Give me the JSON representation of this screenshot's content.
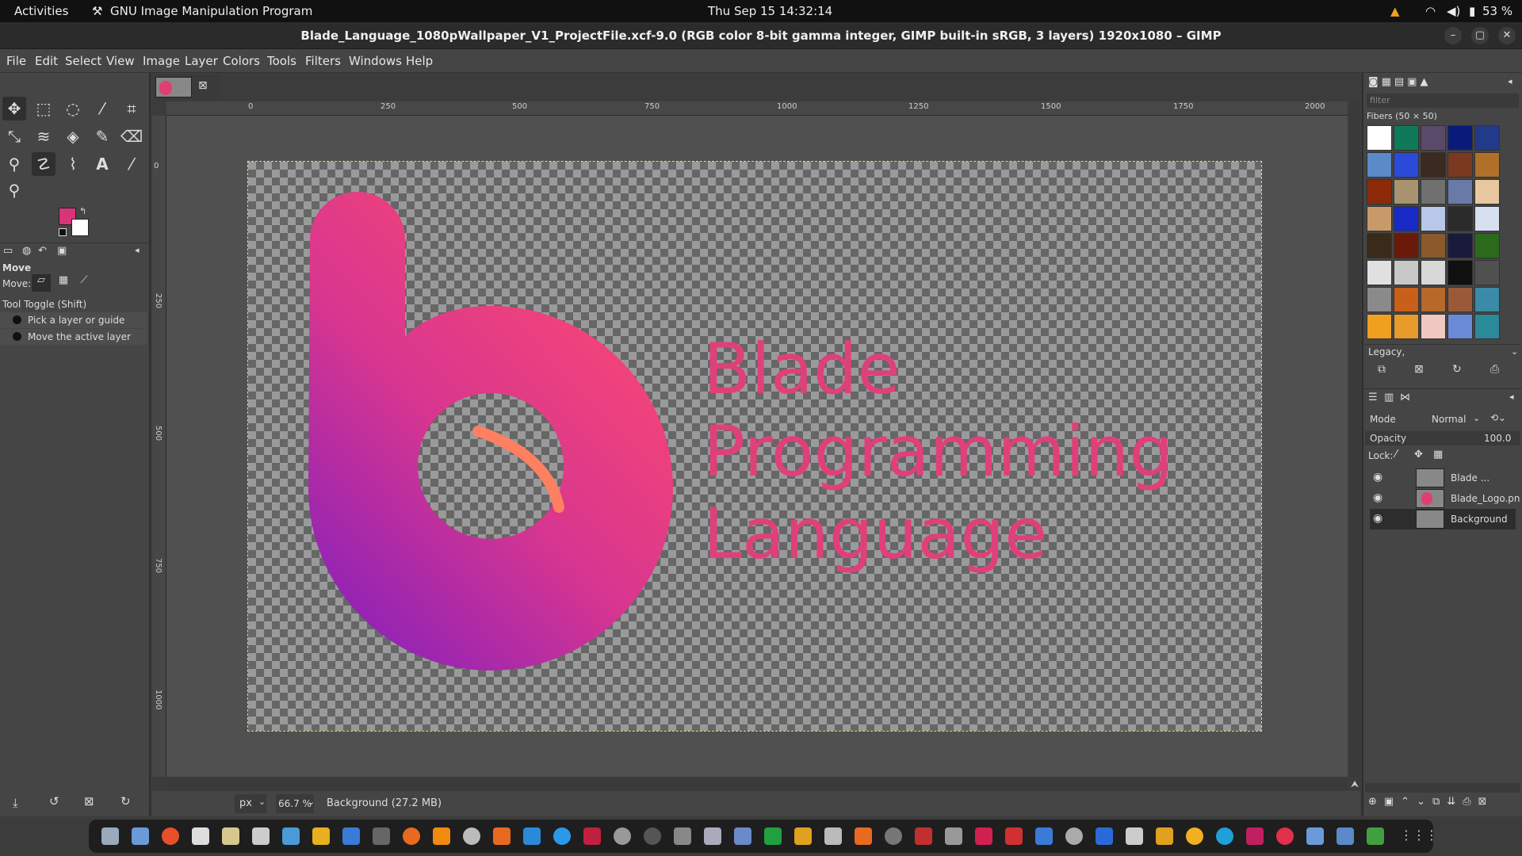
{
  "topbar": {
    "activities": "Activities",
    "app_name": "GNU Image Manipulation Program",
    "clock": "Thu Sep 15  14:32:14",
    "battery": "53 %"
  },
  "window": {
    "title": "Blade_Language_1080pWallpaper_V1_ProjectFile.xcf-9.0 (RGB color 8-bit gamma integer, GIMP built-in sRGB, 3 layers) 1920x1080 – GIMP"
  },
  "menubar": [
    "File",
    "Edit",
    "Select",
    "View",
    "Image",
    "Layer",
    "Colors",
    "Tools",
    "Filters",
    "Windows",
    "Help"
  ],
  "tool_options": {
    "title": "Move",
    "move_label": "Move:",
    "toggle_label": "Tool Toggle  (Shift)",
    "option_1": "Pick a layer or guide",
    "option_2": "Move the active layer"
  },
  "colors": {
    "foreground": "#d9347a",
    "background": "#ffffff",
    "accent": "#e0407a"
  },
  "ruler": {
    "ticks": [
      "0",
      "250",
      "500",
      "750",
      "1000",
      "1250",
      "1500",
      "1750",
      "2000"
    ],
    "left_ticks": [
      "0",
      "250",
      "500",
      "750",
      "1000"
    ]
  },
  "canvas": {
    "text_lines": [
      "Blade",
      "Programming",
      "Language"
    ]
  },
  "statusbar": {
    "unit": "px",
    "zoom": "66.7 %",
    "info": "Background (27.2 MB)"
  },
  "patterns": {
    "filter_placeholder": "filter",
    "name": "Fibers (50 × 50)",
    "tag": "Legacy,"
  },
  "layers": {
    "mode_label": "Mode",
    "mode_value": "Normal",
    "opacity_label": "Opacity",
    "opacity_value": "100.0",
    "lock_label": "Lock:",
    "items": [
      "Blade ...",
      "Blade_Logo.pn",
      "Background"
    ]
  }
}
